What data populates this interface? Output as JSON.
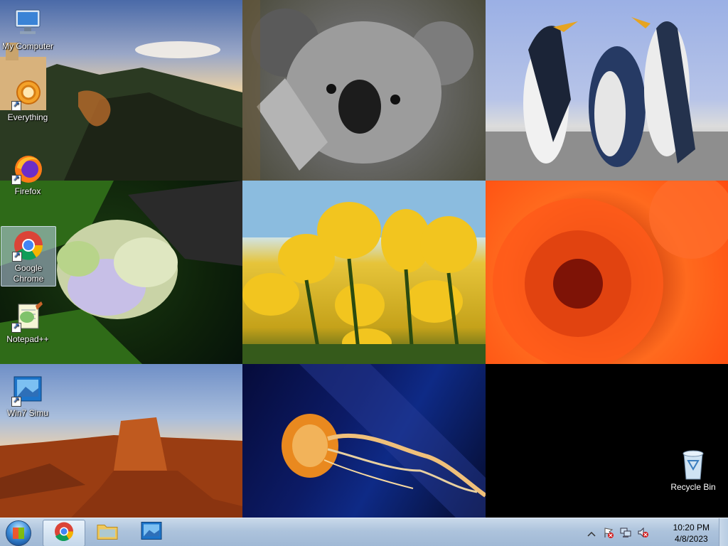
{
  "desktop": {
    "icons": [
      {
        "label": "My Computer",
        "icon": "computer-icon"
      },
      {
        "label": "Everything",
        "icon": "everything-search-icon"
      },
      {
        "label": "Firefox",
        "icon": "firefox-icon"
      },
      {
        "label": "Google Chrome",
        "icon": "chrome-icon"
      },
      {
        "label": "Notepad++",
        "icon": "notepadpp-icon"
      },
      {
        "label": "Win7 Simu",
        "icon": "win7-simu-icon"
      },
      {
        "label": "Recycle Bin",
        "icon": "recycle-bin-icon"
      }
    ]
  },
  "taskbar": {
    "start": {
      "icon": "windows-start-orb"
    },
    "pinned": [
      {
        "name": "chrome-taskbar-button",
        "icon": "chrome-icon"
      },
      {
        "name": "explorer-taskbar-button",
        "icon": "folder-icon"
      },
      {
        "name": "win7-simu-taskbar-button",
        "icon": "win7-simu-icon"
      }
    ],
    "tray": {
      "icons": [
        "show-hidden-icons-icon",
        "action-center-flag-icon",
        "network-icon",
        "volume-muted-icon"
      ],
      "time": "10:20 PM",
      "date": "4/8/2023"
    }
  },
  "colors": {
    "taskbar_top": "#c9d9ea",
    "taskbar_bottom": "#9fb8d5",
    "icon_text": "#ffffff"
  }
}
